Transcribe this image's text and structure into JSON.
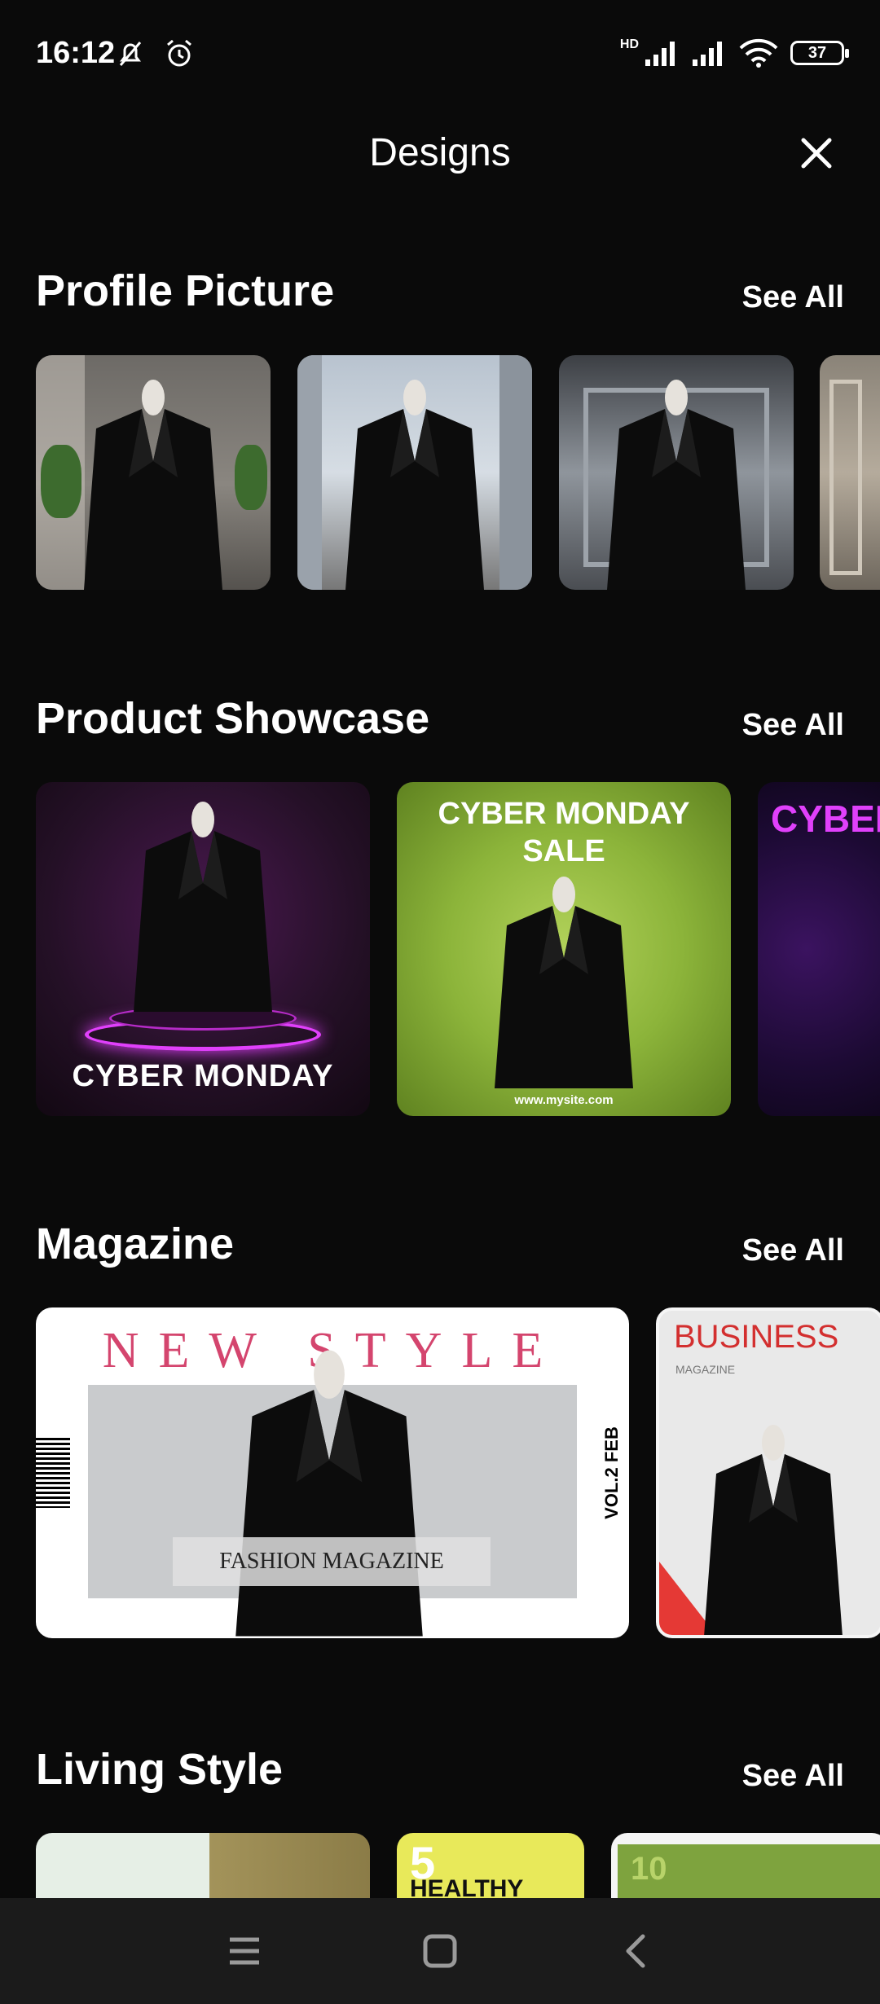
{
  "status": {
    "time": "16:12",
    "battery": "37",
    "network": "HD"
  },
  "header": {
    "title": "Designs",
    "close_icon": "close-icon"
  },
  "sections": [
    {
      "title": "Profile Picture",
      "see_all": "See All"
    },
    {
      "title": "Product Showcase",
      "see_all": "See All",
      "cards": {
        "cyber_monday": "CYBER MONDAY",
        "sale_line1": "CYBER MONDAY",
        "sale_line2": "SALE",
        "site": "www.mysite.com",
        "partial": "CYBER"
      }
    },
    {
      "title": "Magazine",
      "see_all": "See All",
      "cards": {
        "new_style": "NEW STYLE",
        "fashion": "FASHION MAGAZINE",
        "vol": "VOL.2 FEB",
        "business": "BUSINESS",
        "business_sub": "MAGAZINE"
      }
    },
    {
      "title": "Living Style",
      "see_all": "See All",
      "cards": {
        "healthy_num": "5",
        "healthy": "HEALTHY",
        "ten": "10"
      }
    }
  ],
  "colors": {
    "background": "#0a0a0a",
    "accent_magenta": "#e040fb",
    "green": "#8cb43a",
    "magazine_red": "#d32f2f"
  }
}
